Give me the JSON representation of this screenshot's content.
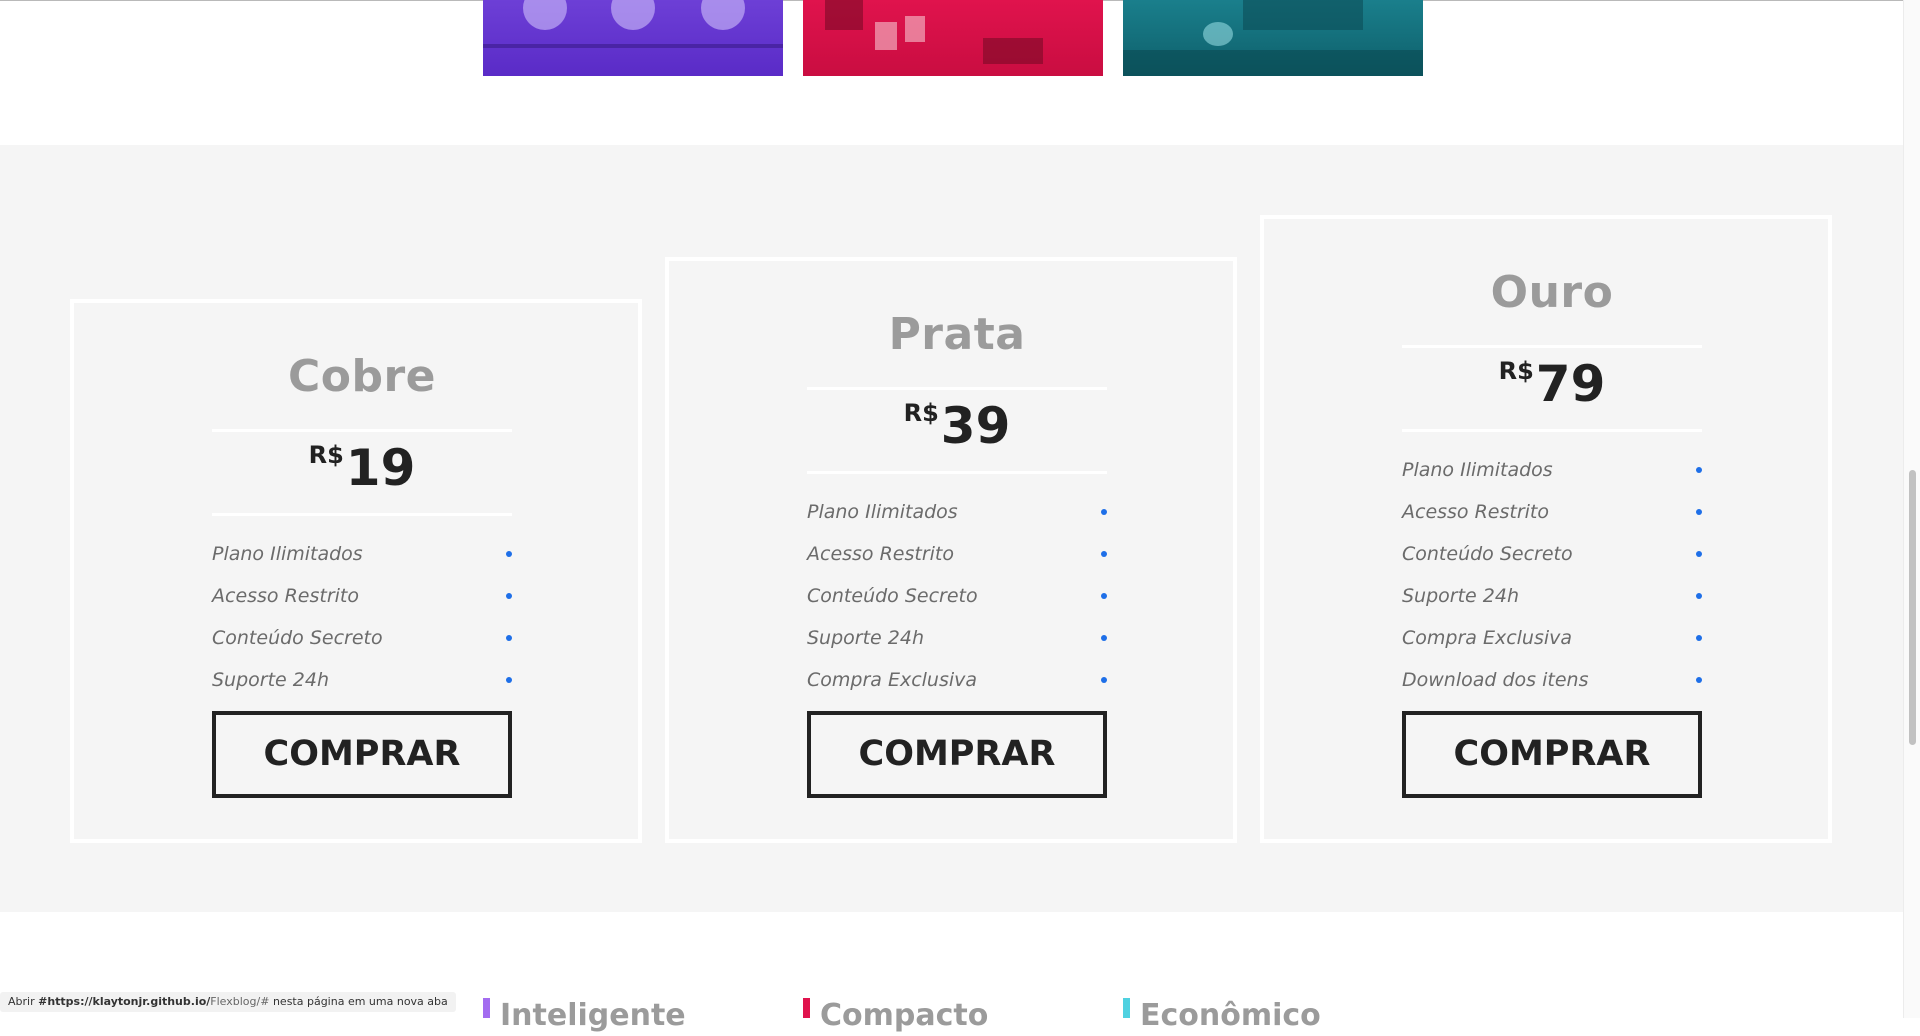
{
  "gallery": {
    "images": [
      "purple-photo",
      "red-photo",
      "teal-photo"
    ]
  },
  "pricing": {
    "plans": [
      {
        "name": "Cobre",
        "currency": "R$",
        "price": "19",
        "features": [
          "Plano Ilimitados",
          "Acesso Restrito",
          "Conteúdo Secreto",
          "Suporte 24h"
        ],
        "button": "COMPRAR"
      },
      {
        "name": "Prata",
        "currency": "R$",
        "price": "39",
        "features": [
          "Plano Ilimitados",
          "Acesso Restrito",
          "Conteúdo Secreto",
          "Suporte 24h",
          "Compra Exclusiva"
        ],
        "button": "COMPRAR"
      },
      {
        "name": "Ouro",
        "currency": "R$",
        "price": "79",
        "features": [
          "Plano Ilimitados",
          "Acesso Restrito",
          "Conteúdo Secreto",
          "Suporte 24h",
          "Compra Exclusiva",
          "Download dos itens"
        ],
        "button": "COMPRAR"
      }
    ],
    "accent_color": "#1e6fe8"
  },
  "features_peek": [
    {
      "label": "Inteligente",
      "color": "#a36cf0"
    },
    {
      "label": "Compacto",
      "color": "#e0134d"
    },
    {
      "label": "Econômico",
      "color": "#4fd1e0"
    }
  ],
  "statusbar": {
    "prefix": "Abrir ",
    "url_host": "#https://klaytonjr.github.io/",
    "url_path": "Flexblog/#",
    "suffix": " nesta página em uma nova aba"
  }
}
